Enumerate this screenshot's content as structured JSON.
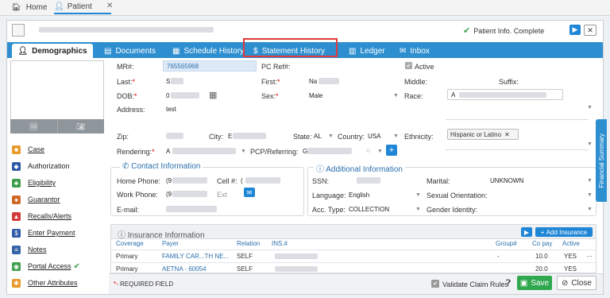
{
  "top_tabs": {
    "home": "Home",
    "patient": "Patient"
  },
  "header": {
    "status": "Patient Info. Complete"
  },
  "nav_tabs": [
    {
      "label": "Demographics"
    },
    {
      "label": "Documents"
    },
    {
      "label": "Schedule History"
    },
    {
      "label": "Statement History"
    },
    {
      "label": "Ledger"
    },
    {
      "label": "Inbox"
    }
  ],
  "sidebar": {
    "items": [
      {
        "label": "Case",
        "color": "#e89a2b"
      },
      {
        "label": "Authorization",
        "color": "#2e5aa8"
      },
      {
        "label": "Eligibility",
        "color": "#3f9e4d"
      },
      {
        "label": "Guarantor",
        "color": "#d06a2a"
      },
      {
        "label": "Recalls/Alerts",
        "color": "#d23a3a"
      },
      {
        "label": "Enter Payment",
        "color": "#2e5aa8"
      },
      {
        "label": "Notes",
        "color": "#3564a8"
      },
      {
        "label": "Portal Access",
        "color": "#3f9e4d"
      },
      {
        "label": "Other Attributes",
        "color": "#e89a2b"
      }
    ]
  },
  "form": {
    "mrn_label": "MR#:",
    "mrn_value": "765565968",
    "pcref_label": "PC Ref#:",
    "active_label": "Active",
    "last_label": "Last:",
    "last_value": "S",
    "first_label": "First:",
    "first_value": "Na",
    "middle_label": "Middle:",
    "suffix_label": "Suffix:",
    "dob_label": "DOB:",
    "dob_value": "0",
    "sex_label": "Sex:",
    "sex_value": "Male",
    "race_label": "Race:",
    "race_value": "A",
    "address_label": "Address:",
    "address_value": "test",
    "zip_label": "Zip:",
    "city_label": "City:",
    "city_value": "E",
    "state_label": "State:",
    "state_value": "AL",
    "country_label": "Country:",
    "country_value": "USA",
    "ethnicity_label": "Ethnicity:",
    "ethnicity_value": "Hispanic or Latino",
    "rendering_label": "Rendering:",
    "rendering_value": "A",
    "pcp_label": "PCP/Referring:",
    "pcp_value": "G"
  },
  "contact": {
    "title": "Contact Information",
    "home_phone_label": "Home Phone:",
    "home_phone_value": "(9",
    "cell_label": "Cell #:",
    "cell_value": "(",
    "work_phone_label": "Work Phone:",
    "work_phone_value": "(9",
    "ext_label": "Ext",
    "email_label": "E-mail:"
  },
  "additional": {
    "title": "Additional Information",
    "ssn_label": "SSN:",
    "marital_label": "Marital:",
    "marital_value": "UNKNOWN",
    "language_label": "Language:",
    "language_value": "English",
    "orientation_label": "Sexual Orientation:",
    "acc_type_label": "Acc. Type:",
    "acc_type_value": "COLLECTION",
    "gender_label": "Gender Identity:"
  },
  "insurance": {
    "title": "Insurance Information",
    "add_label": "Add Insurance",
    "columns": [
      "Coverage",
      "Payer",
      "Relation",
      "INS.#",
      "Group#",
      "Co pay",
      "Active"
    ],
    "rows": [
      {
        "coverage": "Primary",
        "payer": "FAMILY CAR...TH NE...",
        "relation": "SELF",
        "ins": "",
        "group": "-",
        "copay": "10.0",
        "active": "YES"
      },
      {
        "coverage": "Primary",
        "payer": "AETNA - 60054",
        "relation": "SELF",
        "ins": "",
        "group": "",
        "copay": "20.0",
        "active": "YES"
      }
    ]
  },
  "footer": {
    "required_label": "REQUIRED FIELD",
    "validate_label": "Validate Claim Rules",
    "save_label": "Save",
    "close_label": "Close"
  },
  "side_tab": {
    "label": "Financial Summary"
  },
  "colors": {
    "accent": "#2e8fd0",
    "highlight": "#e03a3a",
    "save": "#2fa84f"
  }
}
